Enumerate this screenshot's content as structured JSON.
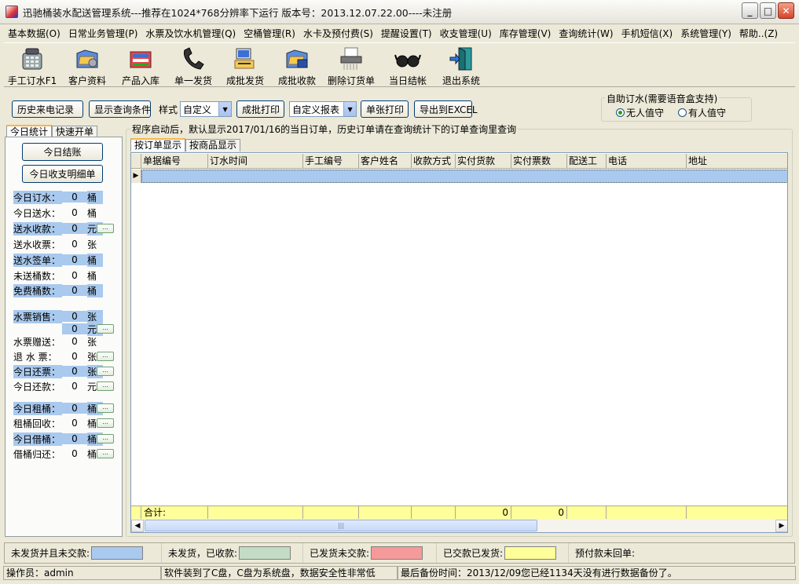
{
  "window": {
    "title": "迅驰桶装水配送管理系统---推荐在1024*768分辨率下运行  版本号：2013.12.07.22.00----未注册",
    "minimize": "_",
    "maximize": "□",
    "close": "✕"
  },
  "menu": [
    "基本数据(O)",
    "日常业务管理(P)",
    "水票及饮水机管理(Q)",
    "空桶管理(R)",
    "水卡及预付费(S)",
    "提醒设置(T)",
    "收支管理(U)",
    "库存管理(V)",
    "查询统计(W)",
    "手机短信(X)",
    "系统管理(Y)",
    "帮助..(Z)"
  ],
  "toolbar": [
    {
      "label": "手工订水F1",
      "icon": "telephone-icon"
    },
    {
      "label": "客户资料",
      "icon": "customer-folder-icon"
    },
    {
      "label": "产品入库",
      "icon": "product-stock-icon"
    },
    {
      "label": "单一发货",
      "icon": "handset-icon"
    },
    {
      "label": "成批发货",
      "icon": "batch-ship-icon"
    },
    {
      "label": "成批收款",
      "icon": "batch-collect-icon"
    },
    {
      "label": "删除订货单",
      "icon": "shredder-icon"
    },
    {
      "label": "当日结帐",
      "icon": "glasses-icon"
    },
    {
      "label": "退出系统",
      "icon": "exit-door-icon"
    }
  ],
  "controls": {
    "history_calls": "历史来电记录",
    "show_query": "显示查询条件",
    "style_label": "样式",
    "style_value": "自定义",
    "batch_print": "成批打印",
    "report_value": "自定义报表",
    "single_print": "单张打印",
    "export_excel": "导出到EXCEL"
  },
  "self_order": {
    "legend": "自助订水(需要语音盒支持)",
    "opt_unattended": "无人值守",
    "opt_attended": "有人值守",
    "selected": "opt_unattended"
  },
  "left_tabs": [
    "今日统计",
    "快速开单"
  ],
  "left_buttons": {
    "settle": "今日结账",
    "detail": "今日收支明细单"
  },
  "stats": [
    {
      "label": "今日订水：",
      "value": "0",
      "unit": "桶",
      "hl": true,
      "dots": false
    },
    {
      "label": "今日送水：",
      "value": "0",
      "unit": "桶",
      "hl": false,
      "dots": false
    },
    {
      "label": "送水收款：",
      "value": "0",
      "unit": "元",
      "hl": true,
      "dots": true
    },
    {
      "label": "送水收票：",
      "value": "0",
      "unit": "张",
      "hl": false,
      "dots": false
    },
    {
      "label": "送水签单：",
      "value": "0",
      "unit": "桶",
      "hl": true,
      "dots": false
    },
    {
      "label": "未送桶数：",
      "value": "0",
      "unit": "桶",
      "hl": false,
      "dots": false
    },
    {
      "label": "免费桶数：",
      "value": "0",
      "unit": "桶",
      "hl": true,
      "dots": false
    },
    {
      "label": "水票销售：",
      "value": "0",
      "unit": "张",
      "hl": true,
      "dots": false
    },
    {
      "label": "",
      "value": "0",
      "unit": "元",
      "hl": true,
      "dots": true
    },
    {
      "label": "水票赠送：",
      "value": "0",
      "unit": "张",
      "hl": false,
      "dots": false
    },
    {
      "label": "退 水 票：",
      "value": "0",
      "unit": "张",
      "hl": false,
      "dots": true
    },
    {
      "label": "今日还票：",
      "value": "0",
      "unit": "张",
      "hl": true,
      "dots": true
    },
    {
      "label": "今日还款：",
      "value": "0",
      "unit": "元",
      "hl": false,
      "dots": true
    },
    {
      "label": "今日租桶：",
      "value": "0",
      "unit": "桶",
      "hl": true,
      "dots": true
    },
    {
      "label": "租桶回收：",
      "value": "0",
      "unit": "桶",
      "hl": false,
      "dots": true
    },
    {
      "label": "今日借桶：",
      "value": "0",
      "unit": "桶",
      "hl": true,
      "dots": true
    },
    {
      "label": "借桶归还：",
      "value": "0",
      "unit": "桶",
      "hl": false,
      "dots": true
    }
  ],
  "main": {
    "caption": "程序启动后，默认显示2017/01/16的当日订单，历史订单请在查询统计下的订单查询里查询",
    "tabs": [
      "按订单显示",
      "按商品显示"
    ]
  },
  "grid": {
    "columns": [
      "单据编号",
      "订水时间",
      "手工编号",
      "客户姓名",
      "收款方式",
      "实付货款",
      "实付票数",
      "配送工",
      "电话",
      "地址"
    ],
    "footer": [
      "合计:",
      "",
      "",
      "",
      "",
      "0",
      "0",
      "",
      "",
      ""
    ]
  },
  "legend": [
    {
      "label": "未发货并且未交款:",
      "color": "#a9c9ee"
    },
    {
      "label": "未发货，已收款:",
      "color": "#c3dcc3"
    },
    {
      "label": "已发货未交款:",
      "color": "#f49a9a"
    },
    {
      "label": "已交款已发货:",
      "color": "#ffff99"
    }
  ],
  "prepay_label": "预付款未回单:",
  "status": {
    "operator": "操作员：admin",
    "disk": "软件装到了C盘，C盘为系统盘，数据安全性非常低",
    "backup": "最后备份时间：2013/12/09您已经1134天没有进行数据备份了。"
  },
  "colors": {
    "highlight": "#a9c9ee",
    "footer": "#ffff99",
    "selected_row": "#a9c9ee"
  }
}
